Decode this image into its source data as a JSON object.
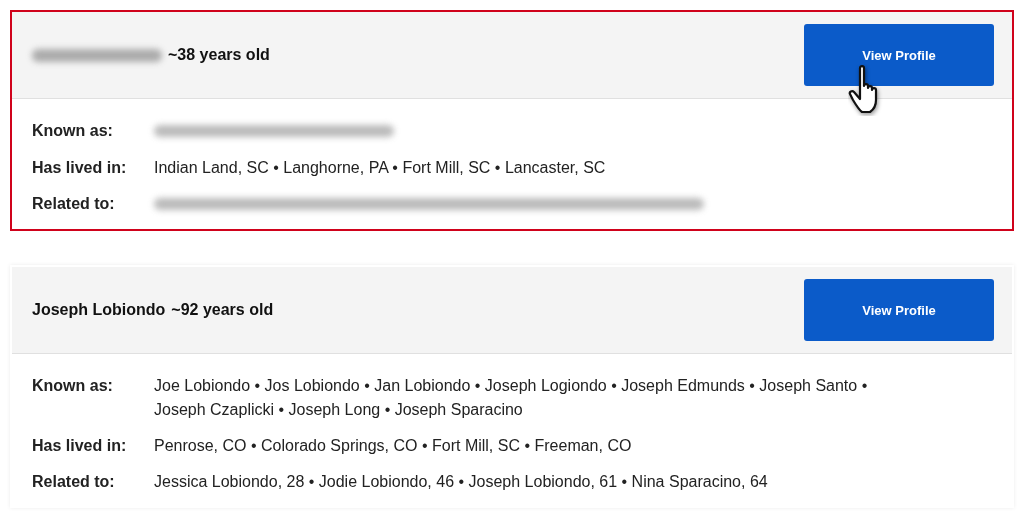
{
  "cards": [
    {
      "highlighted": true,
      "cursor": true,
      "name": {
        "kind": "blurred"
      },
      "age": "~38 years old",
      "button": "View Profile",
      "rows": [
        {
          "label": "Known as:",
          "kind": "blurred"
        },
        {
          "label": "Has lived in:",
          "kind": "text",
          "value": "Indian Land, SC • Langhorne, PA • Fort Mill, SC • Lancaster, SC"
        },
        {
          "label": "Related to:",
          "kind": "blurred"
        }
      ]
    },
    {
      "highlighted": false,
      "cursor": false,
      "name": {
        "kind": "text",
        "text": "Joseph Lobiondo"
      },
      "age": "~92 years old",
      "button": "View Profile",
      "rows": [
        {
          "label": "Known as:",
          "kind": "text",
          "value": "Joe Lobiondo • Jos Lobiondo • Jan Lobiondo • Joseph Logiondo • Joseph Edmunds • Joseph Santo • Joseph Czaplicki • Joseph Long • Joseph Sparacino"
        },
        {
          "label": "Has lived in:",
          "kind": "text",
          "value": "Penrose, CO • Colorado Springs, CO • Fort Mill, SC • Freeman, CO"
        },
        {
          "label": "Related to:",
          "kind": "text",
          "value": "Jessica Lobiondo, 28 • Jodie Lobiondo, 46 • Joseph Lobiondo, 61 • Nina Sparacino, 64"
        }
      ]
    }
  ]
}
